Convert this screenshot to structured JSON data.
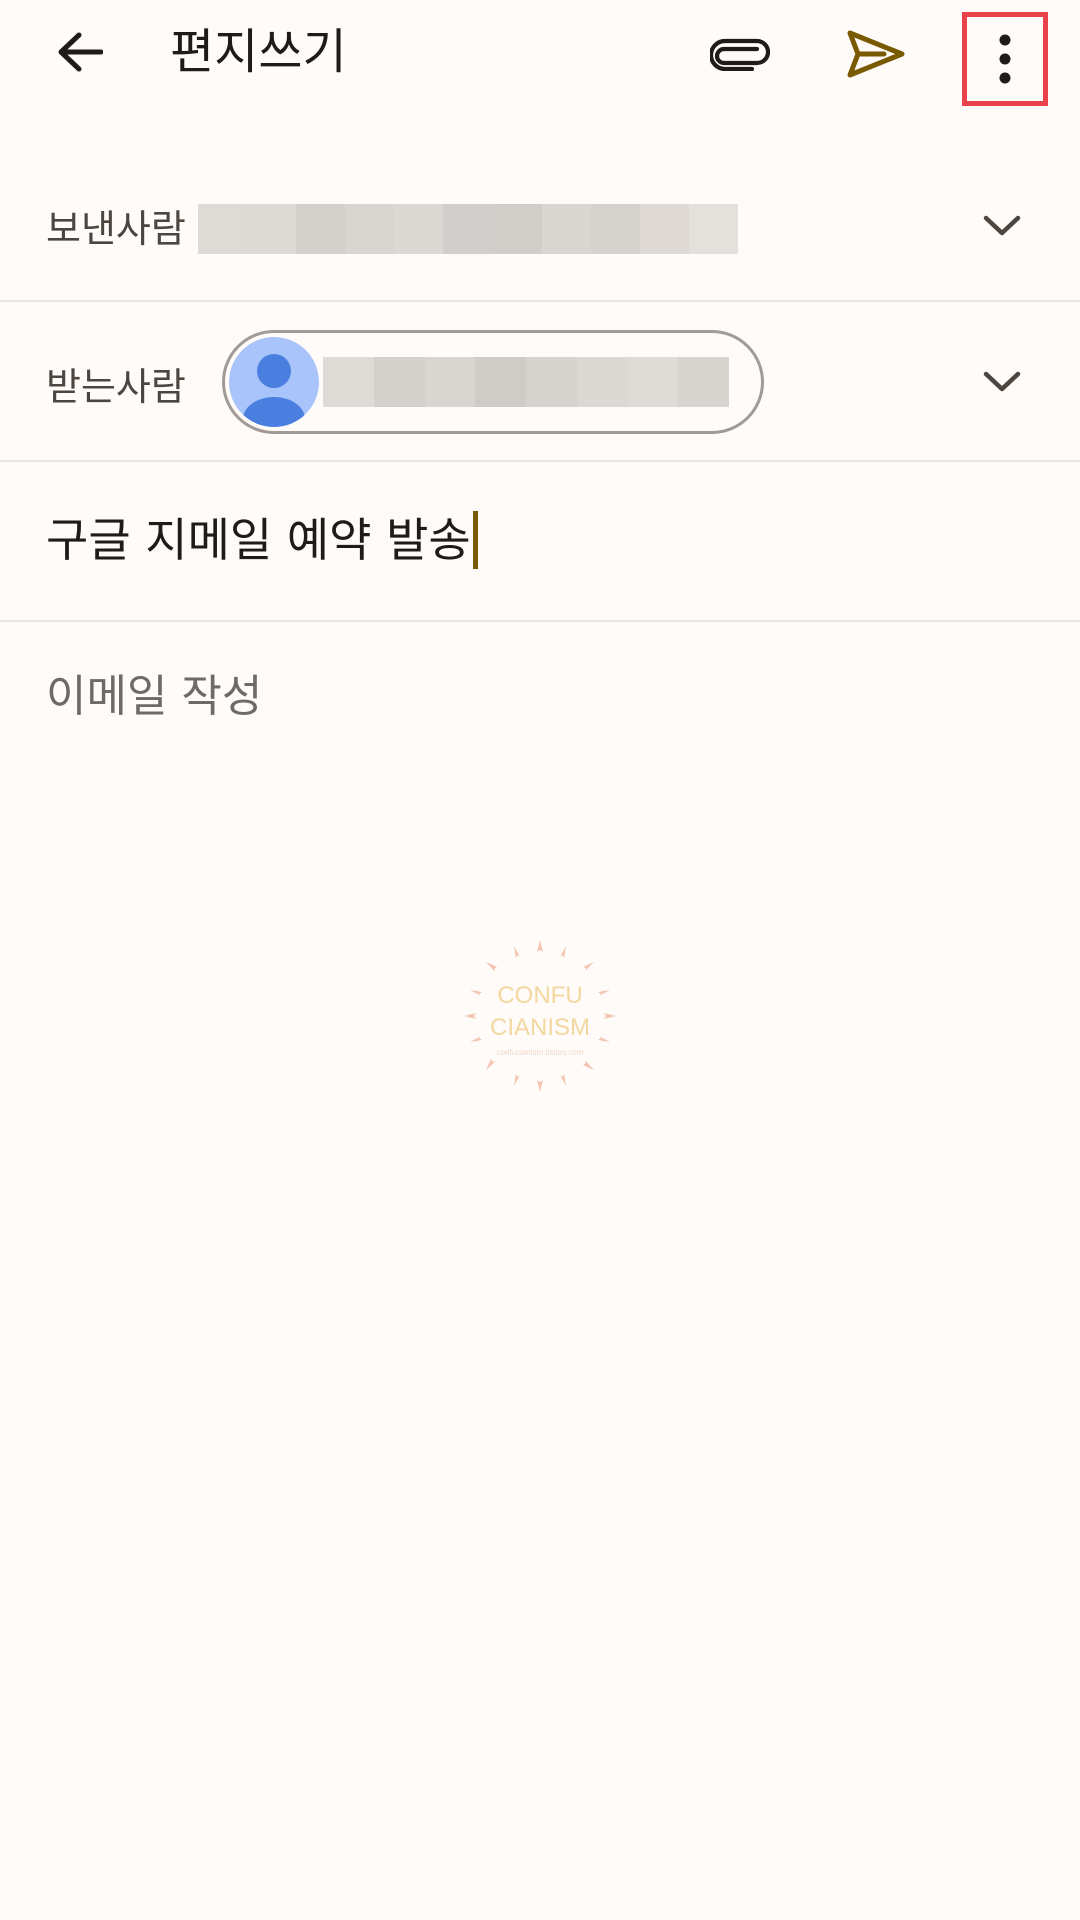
{
  "appbar": {
    "title": "편지쓰기",
    "icons": {
      "back": "arrow-left-icon",
      "attach": "paperclip-icon",
      "send": "send-icon",
      "more": "more-vertical-icon"
    },
    "colors": {
      "send_icon": "#7a5a00",
      "highlight_box": "#e8434a"
    }
  },
  "compose": {
    "from_label": "보낸사람",
    "to_label": "받는사람",
    "subject": "구글 지메일 예약 발송",
    "body_placeholder": "이메일 작성"
  },
  "watermark": {
    "line1": "CONFU",
    "line2": "CIANISM",
    "line3": "confucianism.tistory.com"
  },
  "colors": {
    "background": "#fffbf8",
    "avatar_bg": "#a8c4fb",
    "avatar_fg": "#4a7fe0",
    "caret": "#7a5a00"
  }
}
